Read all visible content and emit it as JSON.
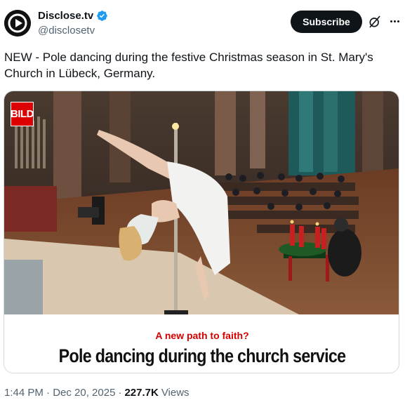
{
  "author": {
    "name": "Disclose.tv",
    "handle": "@disclosetv",
    "verified_icon": "verified-badge-icon",
    "avatar_icon": "play-logo-icon"
  },
  "actions": {
    "subscribe_label": "Subscribe",
    "grok_icon": "grok-icon",
    "more_icon": "more-options-icon"
  },
  "tweet": {
    "text": "NEW - Pole dancing during the festive Christmas season in St. Mary's Church in Lübeck, Germany."
  },
  "media": {
    "logo": "BILD",
    "kicker": "A new path to faith?",
    "headline": "Pole dancing during the church service"
  },
  "meta": {
    "timestamp": "1:44 PM · Dec 20, 2025",
    "separator": "·",
    "views_count": "227.7K",
    "views_label": "Views"
  },
  "colors": {
    "accent": "#1d9bf0",
    "bild_red": "#dd0000",
    "kicker_red": "#d50000",
    "subscribe_bg": "#0f1419",
    "muted_text": "#536471"
  }
}
